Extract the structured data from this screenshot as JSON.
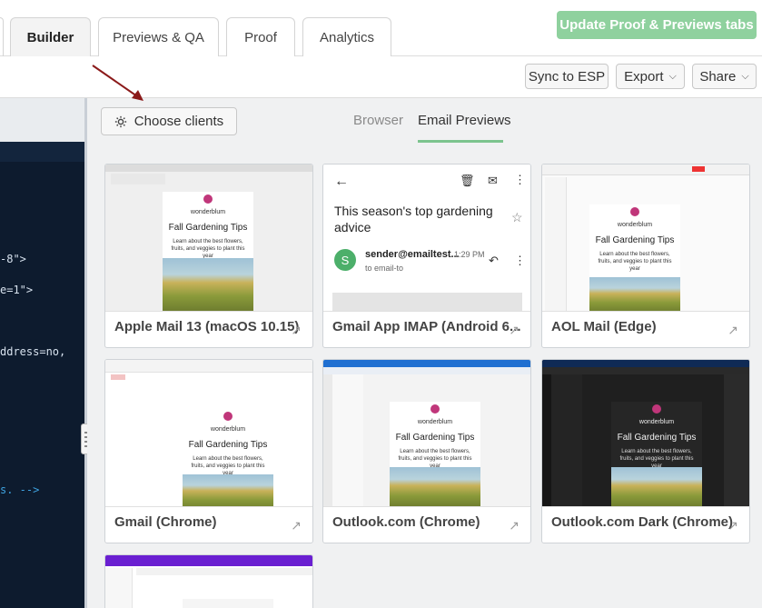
{
  "top_tabs": [
    {
      "label": "Builder",
      "active": true
    },
    {
      "label": "Previews & QA",
      "active": false
    },
    {
      "label": "Proof",
      "active": false
    },
    {
      "label": "Analytics",
      "active": false
    }
  ],
  "update_button": "Update Proof & Previews tabs",
  "toolbar": {
    "sync": "Sync to ESP",
    "export": "Export",
    "share": "Share"
  },
  "choose_clients": "Choose clients",
  "view_tabs": {
    "browser": "Browser",
    "email_previews": "Email Previews"
  },
  "code_lines": [
    "-8\">",
    "e=1\">",
    "ddress=no,",
    "s. -->"
  ],
  "email": {
    "brand": "wonderblum",
    "title": "Fall Gardening Tips",
    "body": "Learn about the best flowers, fruits, and veggies to plant this year",
    "subject": "This season's top gardening advice",
    "sender": "sender@emailtest...",
    "time": "1:29 PM",
    "to": "to email-to",
    "avatar": "S"
  },
  "cards": [
    {
      "label": "Apple Mail 13 (macOS 10.15)"
    },
    {
      "label": "Gmail App IMAP (Android 6..."
    },
    {
      "label": "AOL Mail (Edge)"
    },
    {
      "label": "Gmail (Chrome)"
    },
    {
      "label": "Outlook.com (Chrome)"
    },
    {
      "label": "Outlook.com Dark (Chrome)"
    }
  ],
  "colors": {
    "accent_green": "#8fd19e",
    "code_bg": "#0d1b2e",
    "tab_underline": "#7cc48e"
  }
}
